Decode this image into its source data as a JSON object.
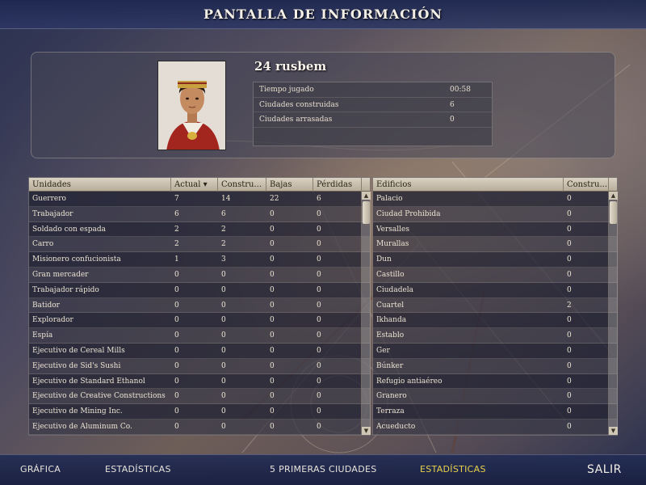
{
  "header": {
    "title": "PANTALLA DE INFORMACIÓN"
  },
  "player": {
    "name": "24 rusbem",
    "stats": [
      {
        "label": "Tiempo jugado",
        "value": "00:58"
      },
      {
        "label": "Ciudades construidas",
        "value": "6"
      },
      {
        "label": "Ciudades arrasadas",
        "value": "0"
      }
    ]
  },
  "units_table": {
    "columns": [
      "Unidades",
      "Actual",
      "Constru...",
      "Bajas",
      "Pérdidas"
    ],
    "sort_icon": "▾",
    "rows": [
      [
        "Guerrero",
        "7",
        "14",
        "22",
        "6"
      ],
      [
        "Trabajador",
        "6",
        "6",
        "0",
        "0"
      ],
      [
        "Soldado con espada",
        "2",
        "2",
        "0",
        "0"
      ],
      [
        "Carro",
        "2",
        "2",
        "0",
        "0"
      ],
      [
        "Misionero confucionista",
        "1",
        "3",
        "0",
        "0"
      ],
      [
        "Gran mercader",
        "0",
        "0",
        "0",
        "0"
      ],
      [
        "Trabajador rápido",
        "0",
        "0",
        "0",
        "0"
      ],
      [
        "Batidor",
        "0",
        "0",
        "0",
        "0"
      ],
      [
        "Explorador",
        "0",
        "0",
        "0",
        "0"
      ],
      [
        "Espía",
        "0",
        "0",
        "0",
        "0"
      ],
      [
        "Ejecutivo de Cereal Mills",
        "0",
        "0",
        "0",
        "0"
      ],
      [
        "Ejecutivo de Sid's Sushi",
        "0",
        "0",
        "0",
        "0"
      ],
      [
        "Ejecutivo de Standard Ethanol",
        "0",
        "0",
        "0",
        "0"
      ],
      [
        "Ejecutivo de Creative Constructions",
        "0",
        "0",
        "0",
        "0"
      ],
      [
        "Ejecutivo de Mining Inc.",
        "0",
        "0",
        "0",
        "0"
      ],
      [
        "Ejecutivo de Aluminum Co.",
        "0",
        "0",
        "0",
        "0"
      ]
    ]
  },
  "buildings_table": {
    "columns": [
      "Edificios",
      "Constru..."
    ],
    "rows": [
      [
        "Palacio",
        "0"
      ],
      [
        "Ciudad Prohibida",
        "0"
      ],
      [
        "Versalles",
        "0"
      ],
      [
        "Murallas",
        "0"
      ],
      [
        "Dun",
        "0"
      ],
      [
        "Castillo",
        "0"
      ],
      [
        "Ciudadela",
        "0"
      ],
      [
        "Cuartel",
        "2"
      ],
      [
        "Ikhanda",
        "0"
      ],
      [
        "Establo",
        "0"
      ],
      [
        "Ger",
        "0"
      ],
      [
        "Búnker",
        "0"
      ],
      [
        "Refugio antiaéreo",
        "0"
      ],
      [
        "Granero",
        "0"
      ],
      [
        "Terraza",
        "0"
      ],
      [
        "Acueducto",
        "0"
      ]
    ]
  },
  "footer": {
    "nav": [
      "GRÁFICA",
      "ESTADÍSTICAS",
      "5 PRIMERAS CIUDADES",
      "ESTADÍSTICAS"
    ],
    "exit": "SALIR",
    "active_color": "#e8d24a"
  },
  "icons": {
    "scroll_up": "▲",
    "scroll_down": "▼"
  }
}
